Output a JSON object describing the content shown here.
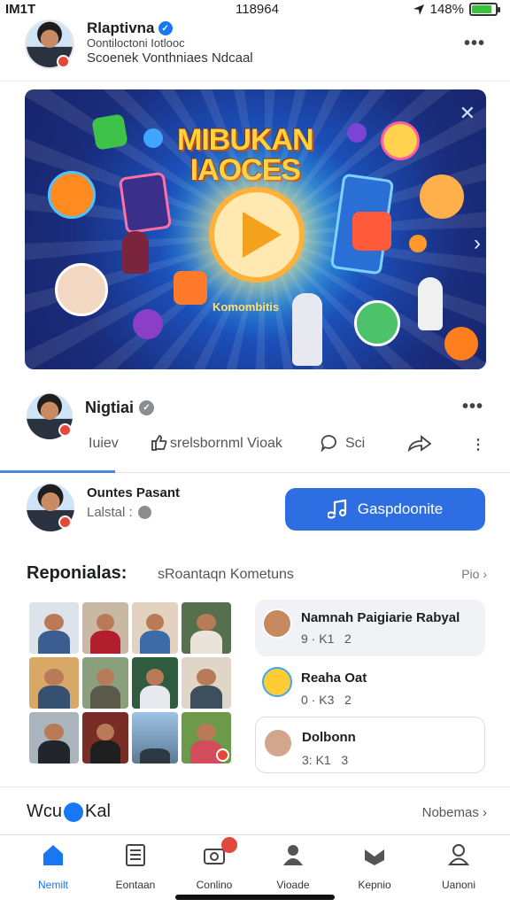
{
  "status_bar": {
    "carrier": "IM1T",
    "time": "118964",
    "battery": "148%",
    "battery_level": 0.85
  },
  "header": {
    "name": "Rlaptivna",
    "line1": "Oontiloctoni Iotlooc",
    "line2": "Scoenek Vonthniaes Ndcaal"
  },
  "banner": {
    "title_line1": "MIBUKAN",
    "title_line2": "IAOCES",
    "caption": "Komombitis",
    "colors": {
      "background": "#1b4fb8",
      "title": "#ffd33d",
      "play": "#f4a21b"
    }
  },
  "post": {
    "author": "Nigtiai",
    "actions": {
      "like": "Iuiev",
      "share": "srelsbornml Vioak",
      "comment": "Sci"
    }
  },
  "contact": {
    "name": "Ountes Pasant",
    "sub": "Lalstal :",
    "cta": "Gaspdoonite"
  },
  "section": {
    "title": "Reponialas:",
    "subtitle": "sRoantaqn Kometuns",
    "link": "Pio"
  },
  "chats": [
    {
      "name": "Namnah Paigiarie Rabyal",
      "meta_a": "9 · K1",
      "meta_b": "2"
    },
    {
      "name": "Reaha Oat",
      "meta_a": "0 · K3",
      "meta_b": "2"
    },
    {
      "name": "Dolbonn",
      "meta_a": "3: K1",
      "meta_b": "3"
    }
  ],
  "footer_section": {
    "title_a": "Wcu",
    "title_b": "Kal",
    "link": "Nobemas"
  },
  "tabs": [
    {
      "label": "Nemilt",
      "icon": "home-icon"
    },
    {
      "label": "Eontaan",
      "icon": "document-icon"
    },
    {
      "label": "Conlino",
      "icon": "camera-icon",
      "badge": ""
    },
    {
      "label": "Vioade",
      "icon": "group-icon"
    },
    {
      "label": "Kepnio",
      "icon": "inbox-icon"
    },
    {
      "label": "Uanoni",
      "icon": "profile-icon"
    }
  ]
}
